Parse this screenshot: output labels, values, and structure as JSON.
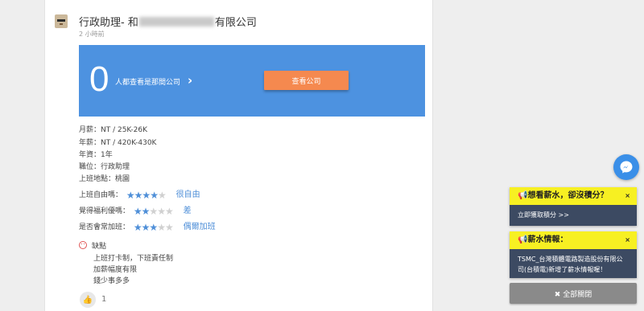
{
  "post": {
    "job_title": "行政助理",
    "company_prefix": "- 和",
    "company_suffix": "有限公司",
    "time_ago": "2 小時前"
  },
  "banner": {
    "count": "0",
    "text": "人都查看是那間公司",
    "button_label": "查看公司",
    "color": "#4d92e0",
    "button_color": "#f5894f"
  },
  "details": {
    "monthly_salary": "月薪：NT / 25K-26K",
    "annual_salary": "年薪：NT / 420K-430K",
    "seniority": "年資：1年",
    "position": "職位：行政助理",
    "location": "上班地點：桃園"
  },
  "ratings": [
    {
      "label": "上班自由嗎：",
      "stars": 4,
      "text": "很自由"
    },
    {
      "label": "覺得福利優嗎：",
      "stars": 2,
      "text": "差"
    },
    {
      "label": "是否會常加班：",
      "stars": 3,
      "text": "偶爾加班"
    }
  ],
  "cons": {
    "heading": "缺點",
    "items": [
      "上班打卡制，下班責任制",
      "加薪幅度有限",
      "錢少事多多"
    ]
  },
  "likes": {
    "count": "1"
  },
  "notifications": [
    {
      "title": "想看薪水，卻沒積分？",
      "body": "立即獲取積分 >>",
      "close": "×"
    },
    {
      "title": "薪水情報：",
      "body": "TSMC_台灣積體電路製造股份有限公司(台積電)新增了薪水情報喔！",
      "close": "×"
    }
  ],
  "close_all": "✖ 全部關閉"
}
